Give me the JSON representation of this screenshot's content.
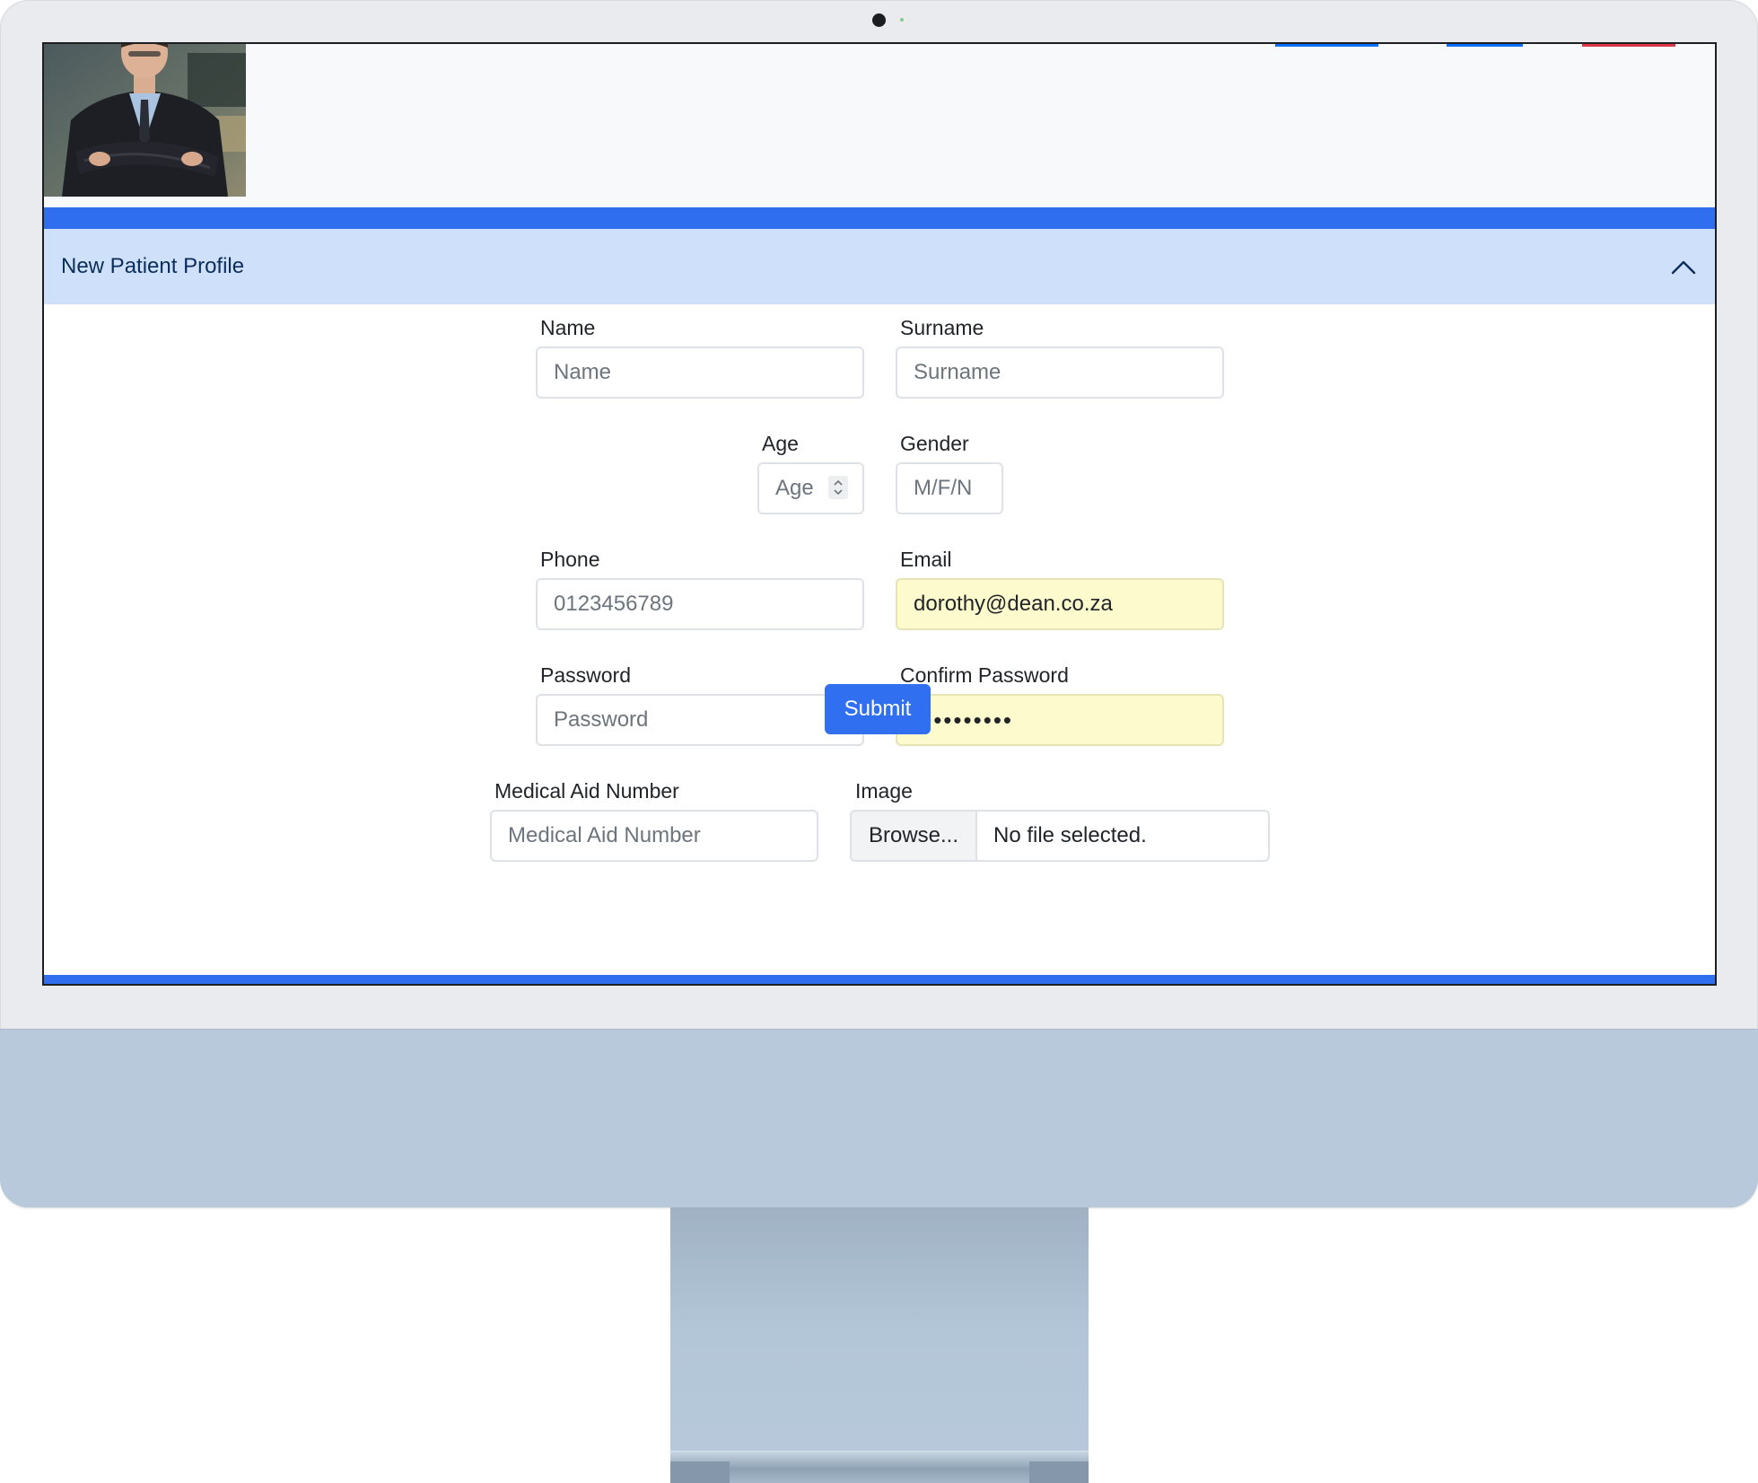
{
  "app": {
    "header_nav_colors": [
      "#0d6efd",
      "#0d6efd",
      "#dc3545"
    ],
    "accent_color": "#306ef0"
  },
  "profile": {
    "avatar_description": "man-in-suit-photo"
  },
  "accordion": {
    "title": "New Patient Profile",
    "toggle_icon": "chevron-up-icon",
    "expanded": true
  },
  "form": {
    "name": {
      "label": "Name",
      "placeholder": "Name",
      "value": ""
    },
    "surname": {
      "label": "Surname",
      "placeholder": "Surname",
      "value": ""
    },
    "age": {
      "label": "Age",
      "placeholder": "Age",
      "value": ""
    },
    "gender": {
      "label": "Gender",
      "placeholder": "M/F/N",
      "value": ""
    },
    "phone": {
      "label": "Phone",
      "placeholder": "0123456789",
      "value": ""
    },
    "email": {
      "label": "Email",
      "placeholder": "",
      "value": "dorothy@dean.co.za"
    },
    "password": {
      "label": "Password",
      "placeholder": "Password",
      "value": ""
    },
    "confirm_password": {
      "label": "Confirm Password",
      "placeholder": "",
      "value": "••••••••••"
    },
    "medical_aid": {
      "label": "Medical Aid Number",
      "placeholder": "Medical Aid Number",
      "value": ""
    },
    "image": {
      "label": "Image",
      "browse_label": "Browse...",
      "status": "No file selected."
    },
    "submit_label": "Submit"
  }
}
